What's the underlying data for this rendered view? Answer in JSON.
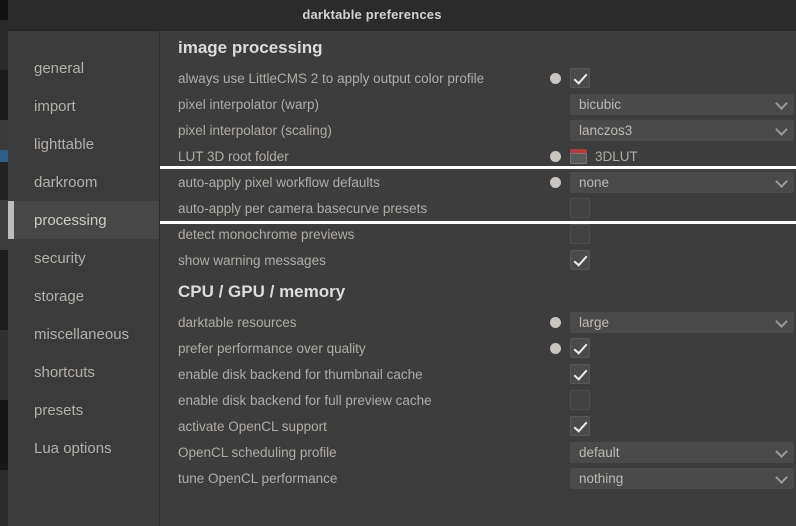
{
  "window": {
    "title": "darktable preferences"
  },
  "sidebar": {
    "items": [
      {
        "label": "general",
        "selected": false
      },
      {
        "label": "import",
        "selected": false
      },
      {
        "label": "lighttable",
        "selected": false
      },
      {
        "label": "darkroom",
        "selected": false
      },
      {
        "label": "processing",
        "selected": true
      },
      {
        "label": "security",
        "selected": false
      },
      {
        "label": "storage",
        "selected": false
      },
      {
        "label": "miscellaneous",
        "selected": false
      },
      {
        "label": "shortcuts",
        "selected": false
      },
      {
        "label": "presets",
        "selected": false
      },
      {
        "label": "Lua options",
        "selected": false
      }
    ]
  },
  "sections": [
    {
      "heading": "image processing",
      "rows": [
        {
          "label": "always use LittleCMS 2 to apply output color profile",
          "control": "checkbox",
          "checked": true,
          "modified_dot": true
        },
        {
          "label": "pixel interpolator (warp)",
          "control": "dropdown",
          "value": "bicubic",
          "modified_dot": false
        },
        {
          "label": "pixel interpolator (scaling)",
          "control": "dropdown",
          "value": "lanczos3",
          "modified_dot": false
        },
        {
          "label": "LUT 3D root folder",
          "control": "folder",
          "value": "3DLUT",
          "icon": "folder-icon",
          "modified_dot": true
        },
        {
          "label": "auto-apply pixel workflow defaults",
          "control": "dropdown",
          "value": "none",
          "modified_dot": true,
          "highlighted": true
        },
        {
          "label": "auto-apply per camera basecurve presets",
          "control": "checkbox",
          "checked": false,
          "modified_dot": false,
          "highlighted": true
        },
        {
          "label": "detect monochrome previews",
          "control": "checkbox",
          "checked": false,
          "modified_dot": false
        },
        {
          "label": "show warning messages",
          "control": "checkbox",
          "checked": true,
          "modified_dot": false
        }
      ]
    },
    {
      "heading": "CPU / GPU / memory",
      "rows": [
        {
          "label": "darktable resources",
          "control": "dropdown",
          "value": "large",
          "modified_dot": true
        },
        {
          "label": "prefer performance over quality",
          "control": "checkbox",
          "checked": true,
          "modified_dot": true
        },
        {
          "label": "enable disk backend for thumbnail cache",
          "control": "checkbox",
          "checked": true,
          "modified_dot": false
        },
        {
          "label": "enable disk backend for full preview cache",
          "control": "checkbox",
          "checked": false,
          "modified_dot": false
        },
        {
          "label": "activate OpenCL support",
          "control": "checkbox",
          "checked": true,
          "modified_dot": false
        },
        {
          "label": "OpenCL scheduling profile",
          "control": "dropdown",
          "value": "default",
          "modified_dot": false
        },
        {
          "label": "tune OpenCL performance",
          "control": "dropdown",
          "value": "nothing",
          "modified_dot": false
        }
      ]
    }
  ],
  "colors": {
    "window_bg": "#3d3d3d",
    "sidebar_bg": "#3b3b3b",
    "titlebar_bg": "#2b2b2b",
    "selection_bar": "#bdbdbd",
    "highlight_outline": "#ffffff",
    "folder_tab": "#b23b39"
  }
}
